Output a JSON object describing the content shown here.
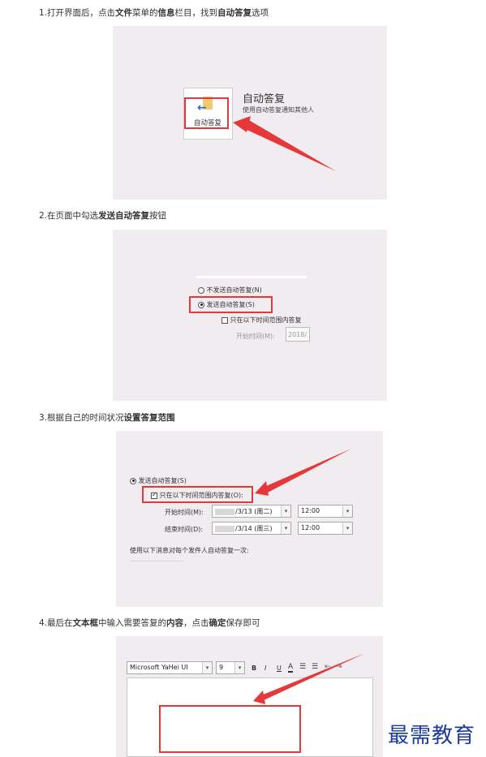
{
  "steps": [
    {
      "pre": "1.打开界面后，点击",
      "b1": "文件",
      "mid1": "菜单的",
      "b2": "信息",
      "mid2": "栏目，找到",
      "b3": "自动答复",
      "post": "选项"
    },
    {
      "pre": "2.在页面中勾选",
      "b1": "发送自动答复",
      "post": "按钮"
    },
    {
      "pre": "3.根据自己的时间状况",
      "b1": "设置答复范围"
    },
    {
      "pre": "4.最后在",
      "b1": "文本框",
      "mid1": "中输入需要答复的",
      "b2": "内容",
      "mid2": "，点击",
      "b3": "确定",
      "post": "保存即可"
    }
  ],
  "panel1": {
    "button_label": "自动答复",
    "title": "自动答复",
    "desc": "使用自动答复通知其他人"
  },
  "panel2": {
    "no_auto": "不发送自动答复(N)",
    "send_auto": "发送自动答复(S)",
    "only_range": "只在以下时间范围内答复",
    "start_label": "开始时间(M):",
    "start_value": "2018/"
  },
  "panel3": {
    "send_auto": "发送自动答复(S)",
    "only_range": "只在以下时间范围内答复(O):",
    "start_label": "开始时间(M):",
    "start_date": "/3/13 (周二)",
    "start_time": "12:00",
    "end_label": "结束时间(D):",
    "end_date": "/3/14 (周三)",
    "end_time": "12:00",
    "note": "使用以下消息对每个发件人自动答复一次:"
  },
  "panel4": {
    "font_name": "Microsoft YaHei UI",
    "font_size": "9",
    "bold": "B",
    "italic": "I",
    "underline": "U",
    "font_color": "A"
  },
  "watermark": "最需教育",
  "colors": {
    "accent_red": "#e5383b",
    "panel_bg": "#f0ecf0",
    "watermark": "#1a3a9c"
  }
}
